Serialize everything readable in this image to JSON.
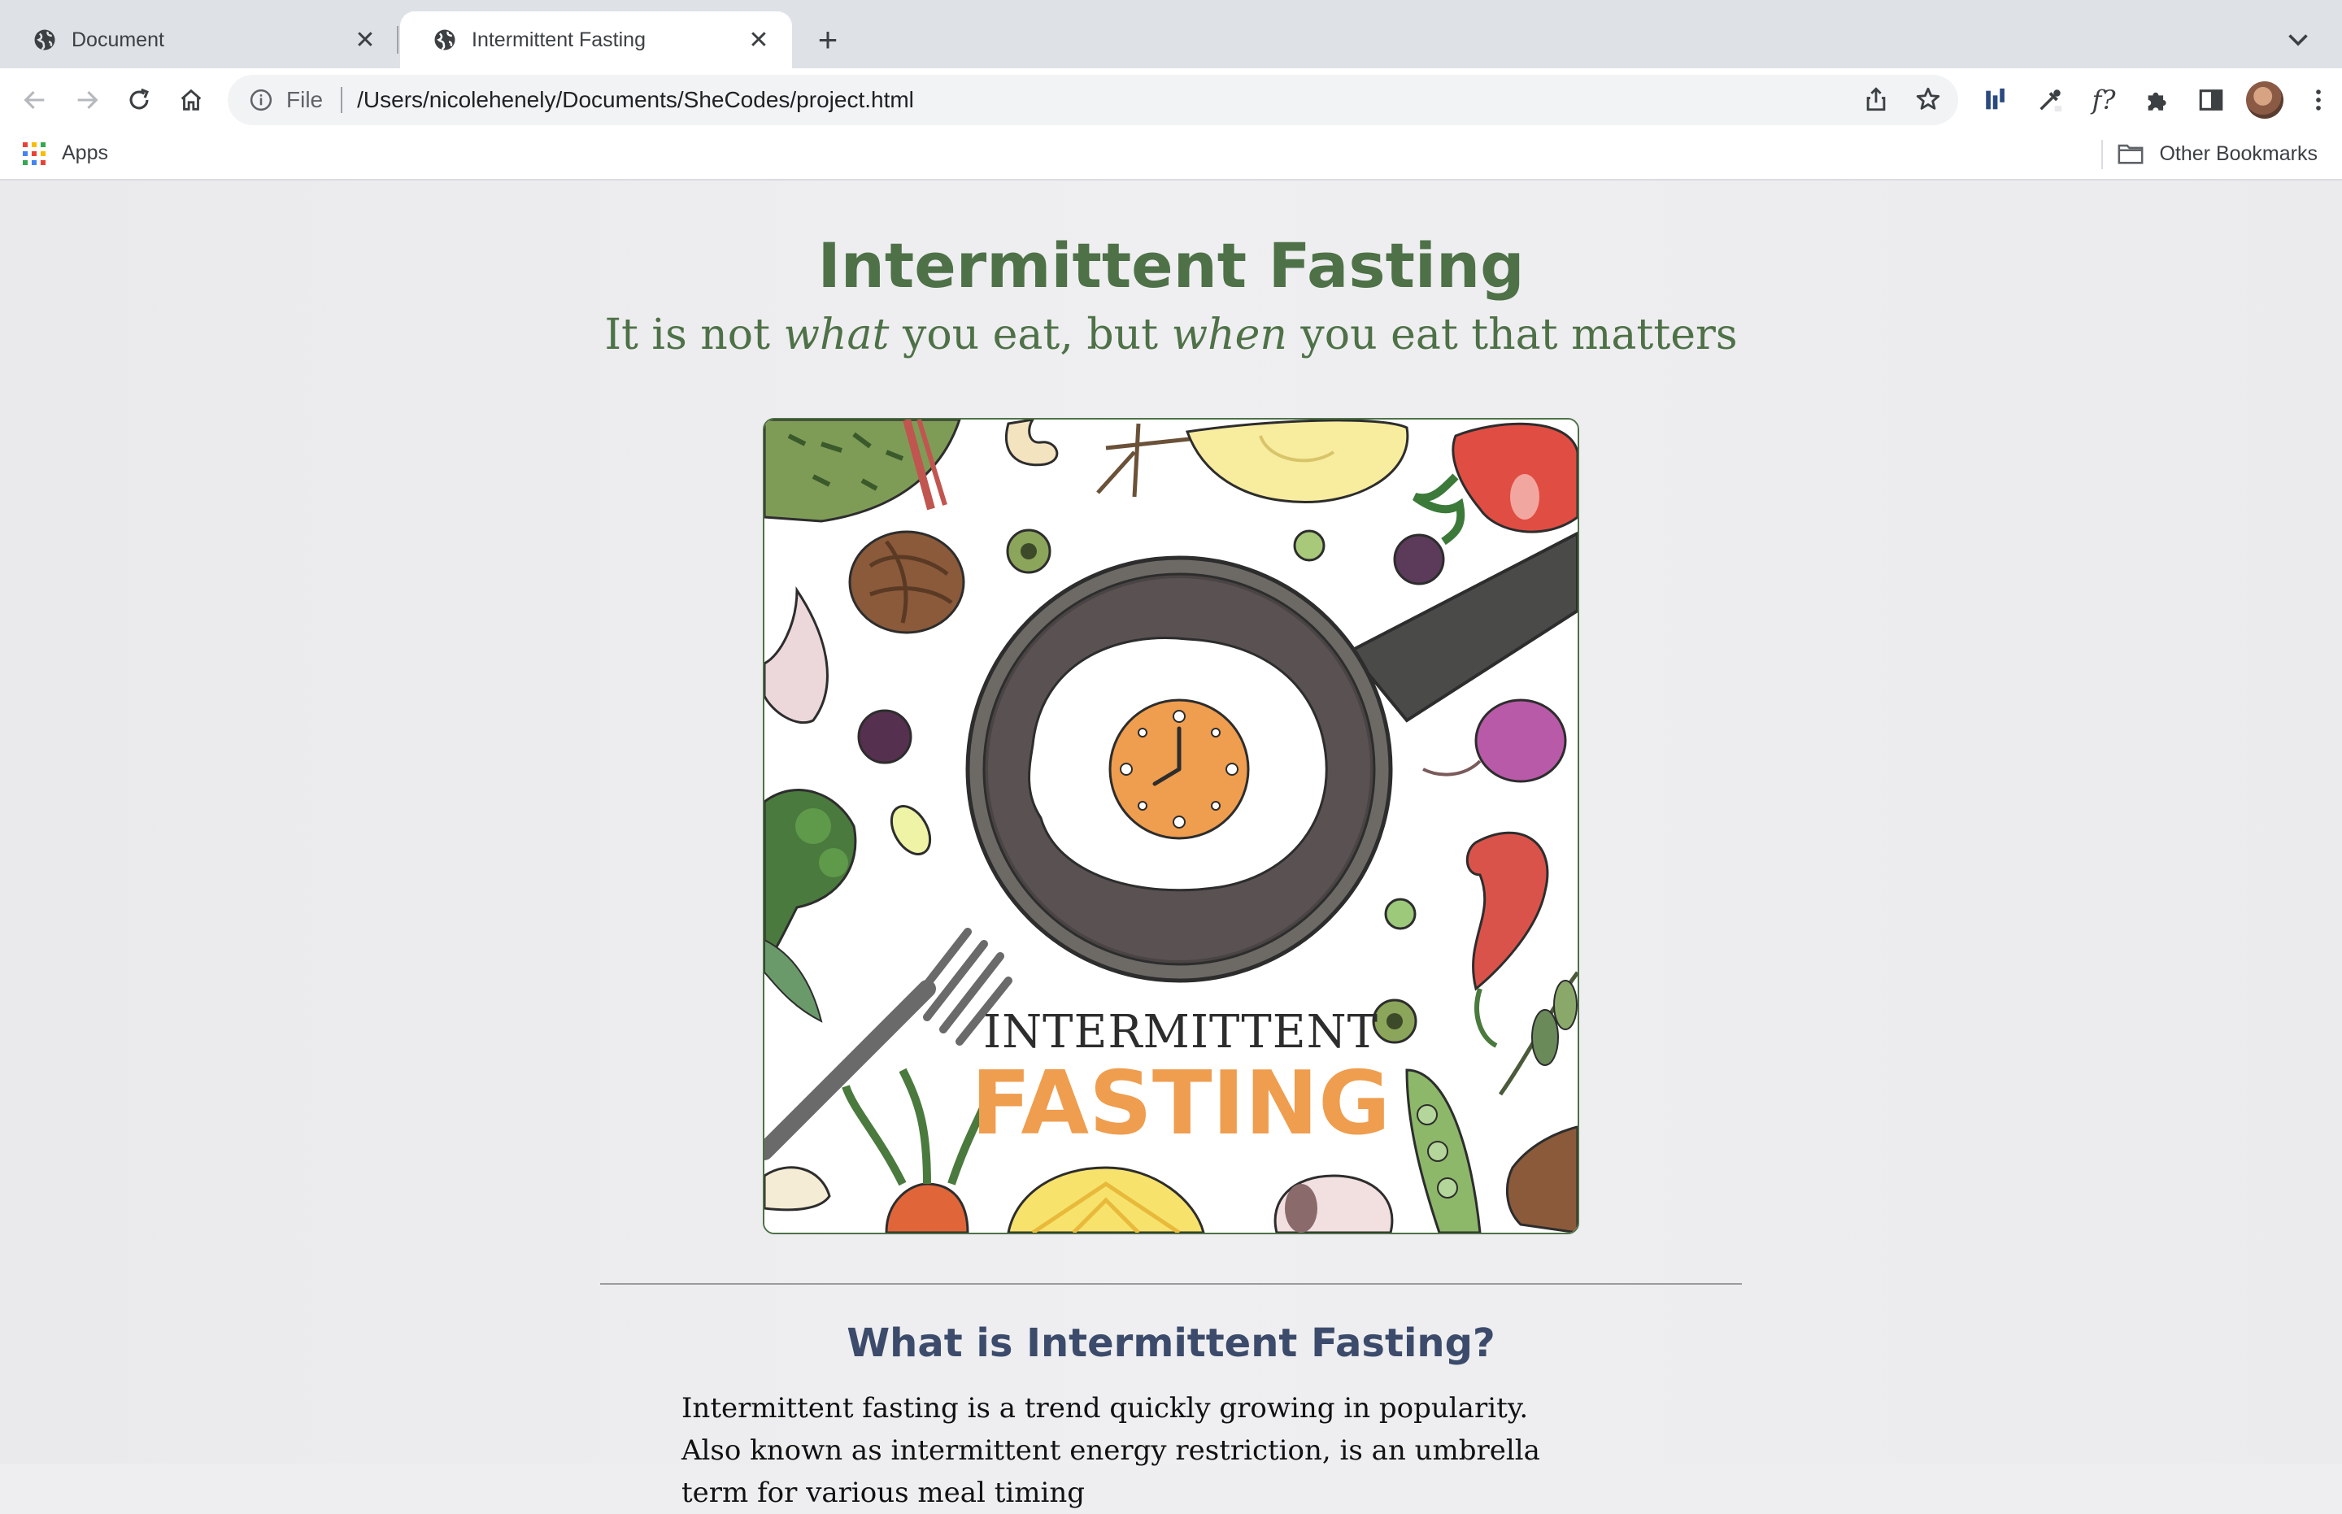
{
  "browser": {
    "tabs": [
      {
        "title": "Document",
        "active": false
      },
      {
        "title": "Intermittent Fasting",
        "active": true
      }
    ],
    "omnibox": {
      "scheme_label": "File",
      "url": "/Users/nicolehenely/Documents/SheCodes/project.html"
    },
    "bookmarks": {
      "apps_label": "Apps",
      "other_label": "Other Bookmarks"
    }
  },
  "page": {
    "title": "Intermittent Fasting",
    "tagline": {
      "part1": "It is not ",
      "em1": "what",
      "part2": " you eat, but ",
      "em2": "when",
      "part3": " you eat that matters"
    },
    "hero_image": {
      "line1": "INTERMITTENT",
      "line2": "FASTING"
    },
    "section": {
      "heading": "What is Intermittent Fasting?",
      "body": "Intermittent fasting is a trend quickly growing in popularity. Also known as intermittent energy restriction, is an umbrella term for various meal timing"
    }
  },
  "colors": {
    "title_green": "#4e7147",
    "heading_navy": "#3c4b6b",
    "tabstrip": "#dee1e6",
    "fasting_orange": "#ef9d4e"
  },
  "icons": {
    "tab": "globe-icon",
    "back": "back-arrow-icon",
    "forward": "forward-arrow-icon",
    "reload": "reload-icon",
    "home": "home-icon",
    "info": "info-icon",
    "share": "share-icon",
    "star": "star-icon",
    "extensions": "puzzle-icon",
    "sidepanel": "side-panel-icon",
    "menu": "kebab-menu-icon",
    "folder": "folder-icon"
  }
}
